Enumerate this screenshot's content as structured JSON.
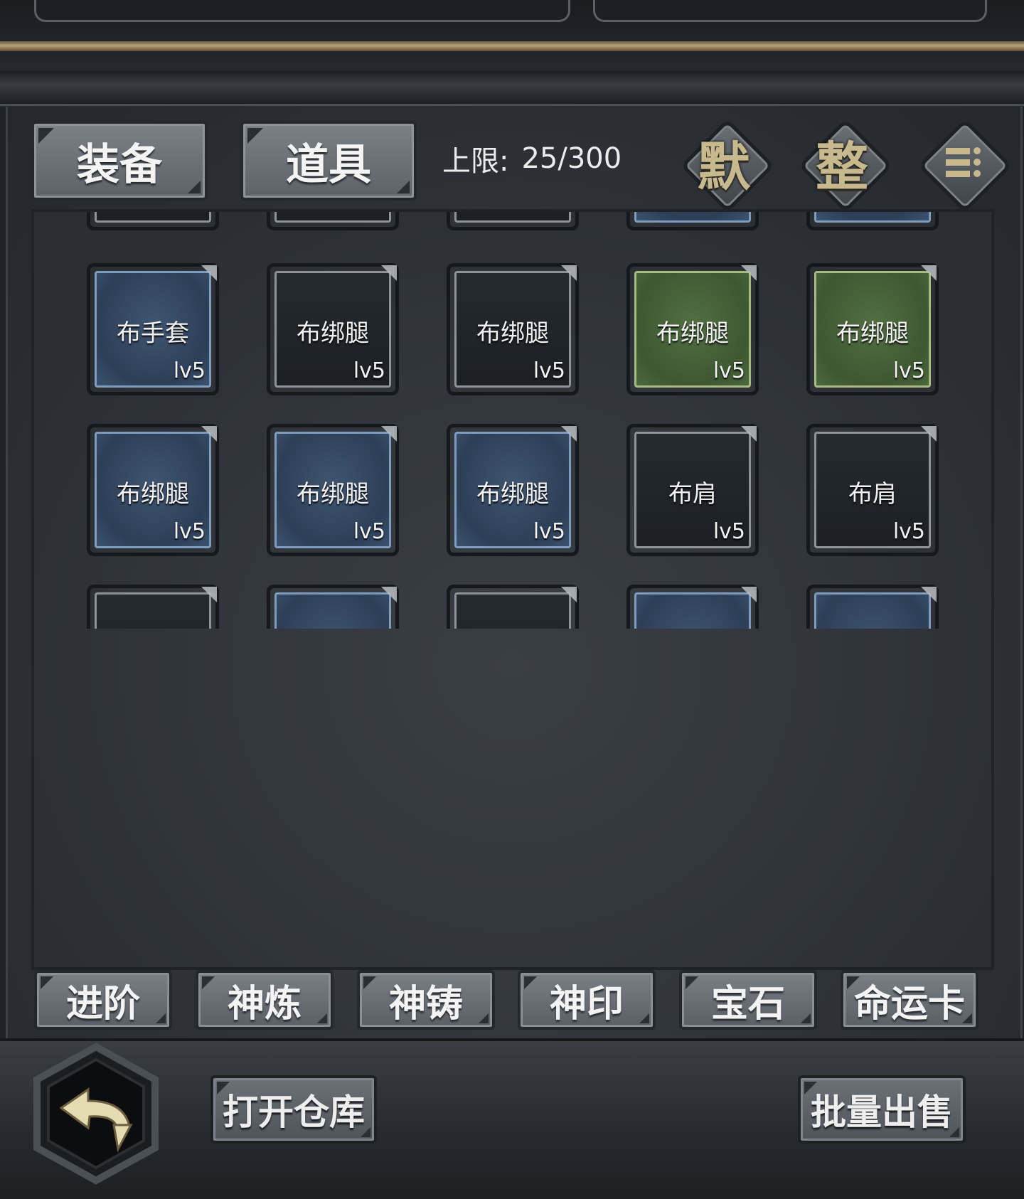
{
  "tabs": {
    "equipment": "装备",
    "items": "道具"
  },
  "capacity": {
    "label": "上限:",
    "value": "25/300"
  },
  "sort_buttons": {
    "default": "默",
    "organize": "整",
    "menu_icon": "list-icon"
  },
  "inventory": {
    "row1": [
      {
        "name": "布手套",
        "level": "lv5",
        "quality": "blue"
      },
      {
        "name": "布绑腿",
        "level": "lv5",
        "quality": "white"
      },
      {
        "name": "布绑腿",
        "level": "lv5",
        "quality": "white"
      },
      {
        "name": "布绑腿",
        "level": "lv5",
        "quality": "green"
      },
      {
        "name": "布绑腿",
        "level": "lv5",
        "quality": "green"
      }
    ],
    "row2": [
      {
        "name": "布绑腿",
        "level": "lv5",
        "quality": "blue"
      },
      {
        "name": "布绑腿",
        "level": "lv5",
        "quality": "blue"
      },
      {
        "name": "布绑腿",
        "level": "lv5",
        "quality": "blue"
      },
      {
        "name": "布肩",
        "level": "lv5",
        "quality": "white"
      },
      {
        "name": "布肩",
        "level": "lv5",
        "quality": "white"
      }
    ]
  },
  "functions": [
    "进阶",
    "神炼",
    "神铸",
    "神印",
    "宝石",
    "命运卡"
  ],
  "actions": {
    "open_warehouse": "打开仓库",
    "batch_sell": "批量出售"
  },
  "colors": {
    "accent_gold": "#c8b88e",
    "quality_white": "#8d9399",
    "quality_blue": "#7f9bbd",
    "quality_green": "#a7bb80"
  }
}
